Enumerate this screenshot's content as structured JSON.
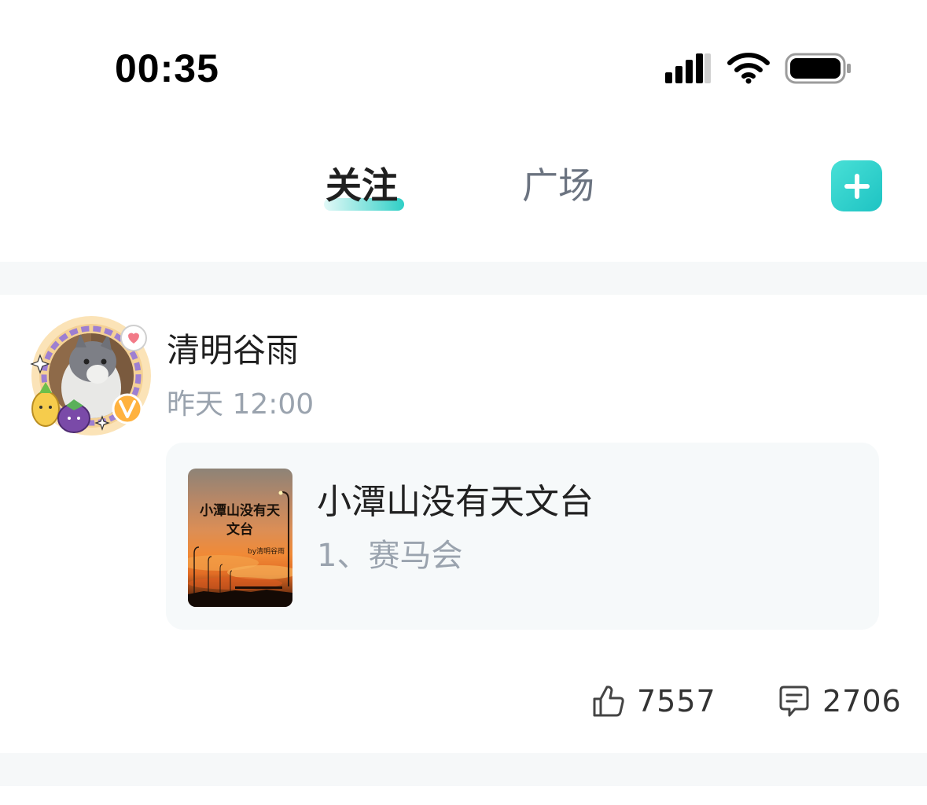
{
  "status_bar": {
    "time": "00:35"
  },
  "header": {
    "tabs": [
      {
        "label": "关注",
        "active": true
      },
      {
        "label": "广场",
        "active": false
      }
    ],
    "accent_color": "#2fcfc6"
  },
  "post": {
    "author": "清明谷雨",
    "time": "昨天 12:00",
    "book": {
      "cover_title": "小潭山没有天文台",
      "cover_author": "by清明谷雨",
      "title": "小潭山没有天文台",
      "chapter": "1、赛马会"
    },
    "likes": "7557",
    "comments": "2706"
  },
  "icons": {
    "signal": "signal-icon",
    "wifi": "wifi-icon",
    "battery": "battery-icon",
    "add": "plus-icon",
    "like": "thumbs-up-icon",
    "comment": "comment-icon"
  }
}
